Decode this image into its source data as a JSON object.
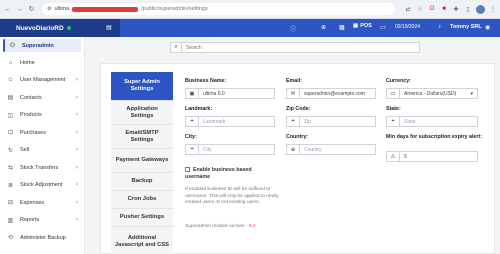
{
  "browser": {
    "url_host": "ultima",
    "url_path": "/public/superadmin/settings"
  },
  "app": {
    "brand": "NuevoDiarioRD",
    "pos_label": "POS",
    "date": "09/19/2024",
    "user": "Tommy SRL"
  },
  "sidebar": {
    "items": [
      {
        "label": "Superadmin",
        "icon": "user-shield-icon",
        "active": true
      },
      {
        "label": "Home",
        "icon": "home-icon"
      },
      {
        "label": "User Management",
        "icon": "users-icon",
        "chevron": true
      },
      {
        "label": "Contacts",
        "icon": "address-book-icon",
        "chevron": true
      },
      {
        "label": "Products",
        "icon": "box-icon",
        "chevron": true
      },
      {
        "label": "Purchases",
        "icon": "cart-icon",
        "chevron": true
      },
      {
        "label": "Sell",
        "icon": "sell-icon",
        "chevron": true
      },
      {
        "label": "Stock Transfers",
        "icon": "truck-icon",
        "chevron": true
      },
      {
        "label": "Stock Adjustment",
        "icon": "database-icon",
        "chevron": true
      },
      {
        "label": "Expenses",
        "icon": "minus-circle-icon",
        "chevron": true
      },
      {
        "label": "Reports",
        "icon": "chart-icon",
        "chevron": true
      },
      {
        "label": "Administer Backup",
        "icon": "backup-icon"
      }
    ]
  },
  "search": {
    "placeholder": "Search"
  },
  "tabs": [
    "Super Admin Settings",
    "Application Settings",
    "Email/SMTP Settings",
    "Payment Gateways",
    "Backup",
    "Cron Jobs",
    "Pusher Settings",
    "Additional Javascript and CSS"
  ],
  "form": {
    "business_name": {
      "label": "Business Name:",
      "value": "ultima 6.0"
    },
    "email": {
      "label": "Email:",
      "value": "superadmin@example.com"
    },
    "currency": {
      "label": "Currency:",
      "value": "America - Dollars(USD)"
    },
    "landmark": {
      "label": "Landmark:",
      "placeholder": "Landmark"
    },
    "zip": {
      "label": "Zip Code:",
      "placeholder": "Zip"
    },
    "state": {
      "label": "State:",
      "placeholder": "State"
    },
    "city": {
      "label": "City:",
      "placeholder": "City"
    },
    "country": {
      "label": "Country:",
      "placeholder": "Country"
    },
    "min_days": {
      "label": "Min days for subscription expiry alert:",
      "value": "5"
    },
    "enable_business_based_username": "Enable business based username",
    "help": "If enabled business ID will be suffixed to username. This will only be applied to newly created users IS not existing users.",
    "version_label": "Superadmin module version - ",
    "version": "6.4"
  }
}
